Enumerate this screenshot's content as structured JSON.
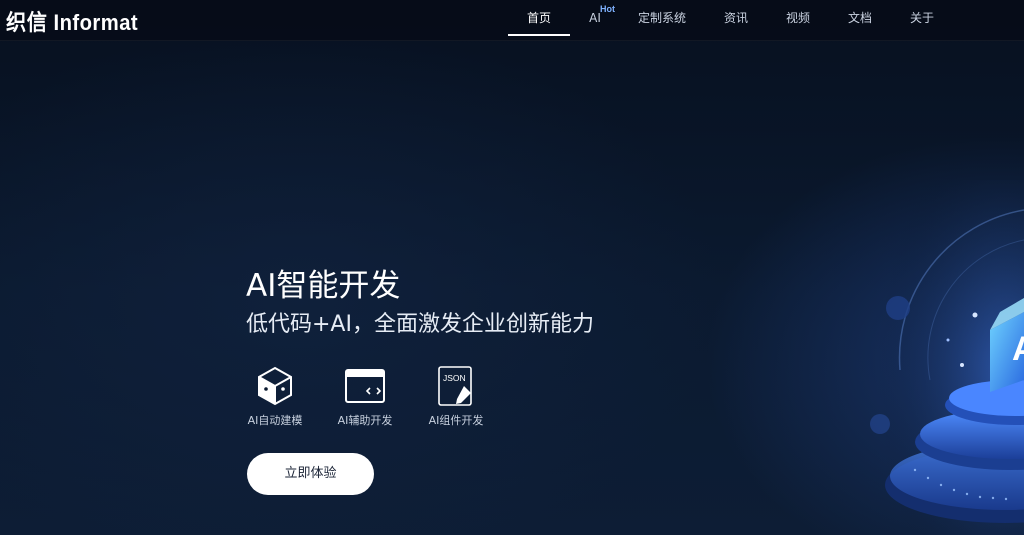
{
  "brand": {
    "logo_text": "织信 Informat"
  },
  "nav": {
    "items": [
      {
        "label": "首页",
        "active": true
      },
      {
        "label": "AI",
        "badge": "Hot"
      },
      {
        "label": "定制系统"
      },
      {
        "label": "资讯"
      },
      {
        "label": "视频"
      },
      {
        "label": "文档"
      },
      {
        "label": "关于"
      }
    ]
  },
  "hero": {
    "title": "AI智能开发",
    "subtitle": "低代码+AI，全面激发企业创新能力",
    "features": [
      {
        "icon": "cube-icon",
        "label": "AI自动建模"
      },
      {
        "icon": "code-window-icon",
        "label": "AI辅助开发"
      },
      {
        "icon": "json-edit-icon",
        "label": "AI组件开发"
      }
    ],
    "cta_label": "立即体验"
  },
  "illustration": {
    "icon": "ai-platform-illustration",
    "glyph": "A"
  },
  "colors": {
    "background": "#0a1628",
    "accent": "#3a7bff",
    "badge": "#7fb2ff"
  }
}
